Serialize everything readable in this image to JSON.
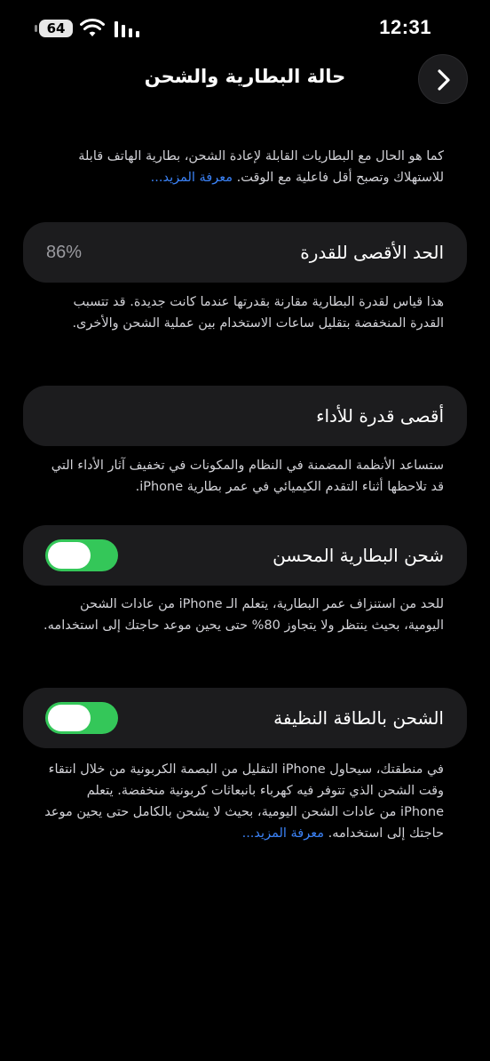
{
  "status_bar": {
    "battery_level": "64",
    "time": "12:31",
    "icons": [
      "battery-icon",
      "wifi-icon",
      "cellular-signal-icon"
    ]
  },
  "header": {
    "title": "حالة البطارية والشحن",
    "back_icon": "chevron-right-icon"
  },
  "intro": {
    "text": "كما هو الحال مع البطاريات القابلة لإعادة الشحن، بطارية الهاتف قابلة للاستهلاك وتصبح أقل فاعلية مع الوقت.",
    "learn_more": "معرفة المزيد..."
  },
  "max_capacity": {
    "label": "الحد الأقصى للقدرة",
    "value": "86%",
    "description": "هذا قياس لقدرة البطارية مقارنة بقدرتها عندما كانت جديدة. قد تتسبب القدرة المنخفضة بتقليل ساعات الاستخدام بين عملية الشحن والأخرى."
  },
  "peak_performance": {
    "label": "أقصى قدرة للأداء",
    "description": "ستساعد الأنظمة المضمنة في النظام والمكونات في تخفيف آثار الأداء التي قد تلاحظها أثناء التقدم الكيميائي في عمر بطارية iPhone."
  },
  "optimized_charging": {
    "label": "شحن البطارية المحسن",
    "enabled": true,
    "description": "للحد من استنزاف عمر البطارية، يتعلم الـ iPhone من عادات الشحن اليومية، بحيث ينتظر ولا يتجاوز 80% حتى يحين موعد حاجتك إلى استخدامه."
  },
  "clean_energy_charging": {
    "label": "الشحن بالطاقة النظيفة",
    "enabled": true,
    "description": "في منطقتك، سيحاول iPhone التقليل من البصمة الكربونية من خلال انتقاء وقت الشحن الذي تتوفر فيه كهرباء بانبعاثات كربونية منخفضة. يتعلم iPhone من عادات الشحن اليومية، بحيث لا يشحن بالكامل حتى يحين موعد حاجتك إلى استخدامه.",
    "learn_more": "معرفة المزيد..."
  },
  "colors": {
    "background": "#000000",
    "card": "#1c1c1e",
    "toggle_on": "#34c759",
    "link": "#3b82f6",
    "secondary_text": "#d2d2d7"
  }
}
